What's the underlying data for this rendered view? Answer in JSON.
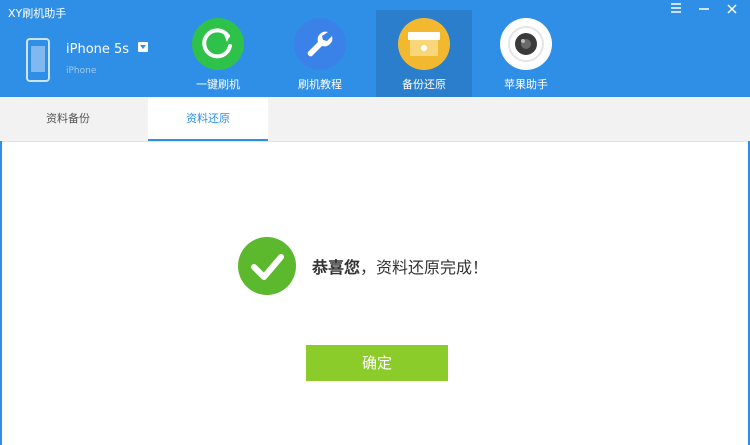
{
  "app": {
    "title": "XY刷机助手"
  },
  "window_controls": {
    "menu_icon": "menu-icon",
    "minimize_icon": "minimize-icon",
    "close_icon": "close-icon"
  },
  "device": {
    "name": "iPhone 5s",
    "subtitle": "iPhone"
  },
  "toolbar": {
    "items": [
      {
        "label": "一键刷机",
        "icon": "refresh-icon",
        "color": "#2fc24a",
        "active": false
      },
      {
        "label": "刷机教程",
        "icon": "wrench-icon",
        "color": "#3b82e8",
        "active": false
      },
      {
        "label": "备份还原",
        "icon": "folder-icon",
        "color": "#f2b930",
        "active": true
      },
      {
        "label": "苹果助手",
        "icon": "camera-icon",
        "color": "#3a3a3a",
        "active": false
      }
    ]
  },
  "tabs": [
    {
      "label": "资料备份",
      "active": false
    },
    {
      "label": "资料还原",
      "active": true
    }
  ],
  "result": {
    "title": "恭喜您",
    "message": "，资料还原完成！"
  },
  "confirm_button": {
    "label": "确定"
  },
  "colors": {
    "brand_blue": "#2f8fe6",
    "success_green": "#5cb82c",
    "button_green": "#8ccc2a"
  }
}
